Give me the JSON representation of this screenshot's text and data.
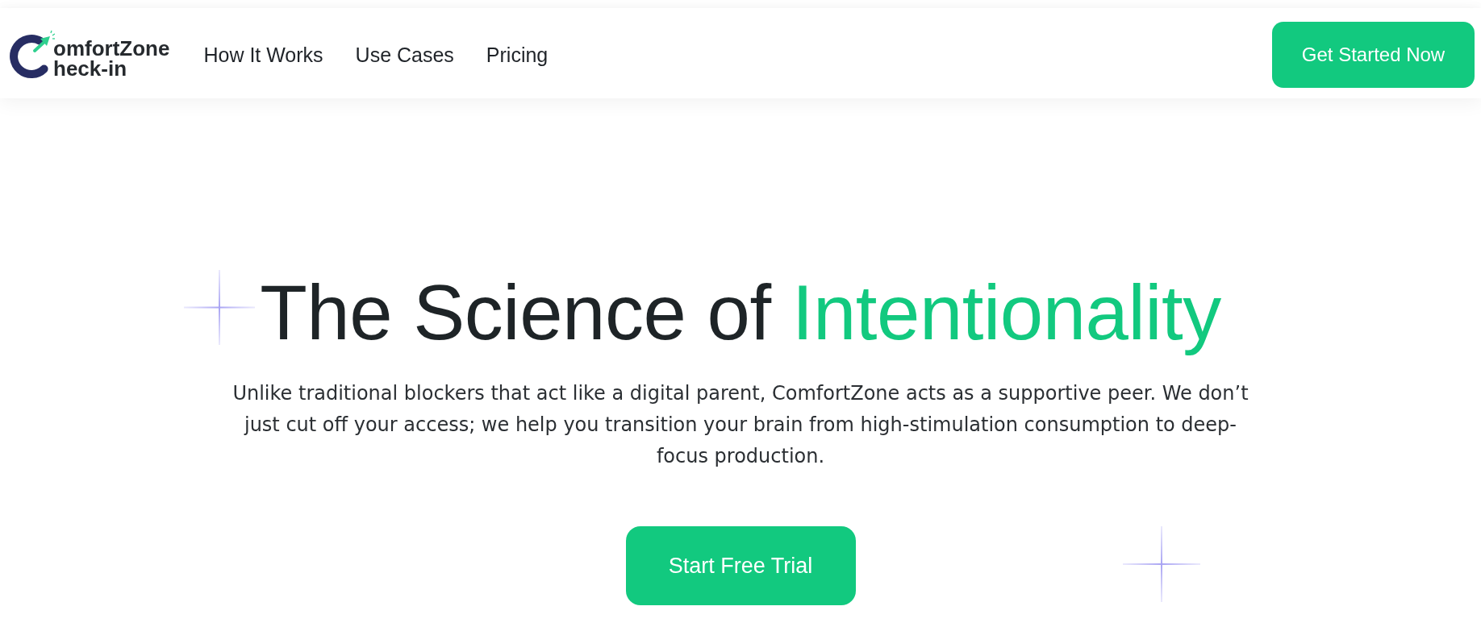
{
  "header": {
    "logo": {
      "line_1": "omfortZone",
      "line_2": "heck-in"
    },
    "nav": [
      {
        "label": "How It Works"
      },
      {
        "label": "Use Cases"
      },
      {
        "label": "Pricing"
      }
    ],
    "cta": "Get Started Now"
  },
  "hero": {
    "title": {
      "text": "The Science of",
      "highlight": "Intentionality"
    },
    "description": "Unlike traditional blockers that act like a digital parent, ComfortZone acts as a supportive peer. We don’t just cut off your access; we help you transition your brain from high-stimulation consumption to deep-focus production.",
    "button": "Start Free Trial"
  }
}
